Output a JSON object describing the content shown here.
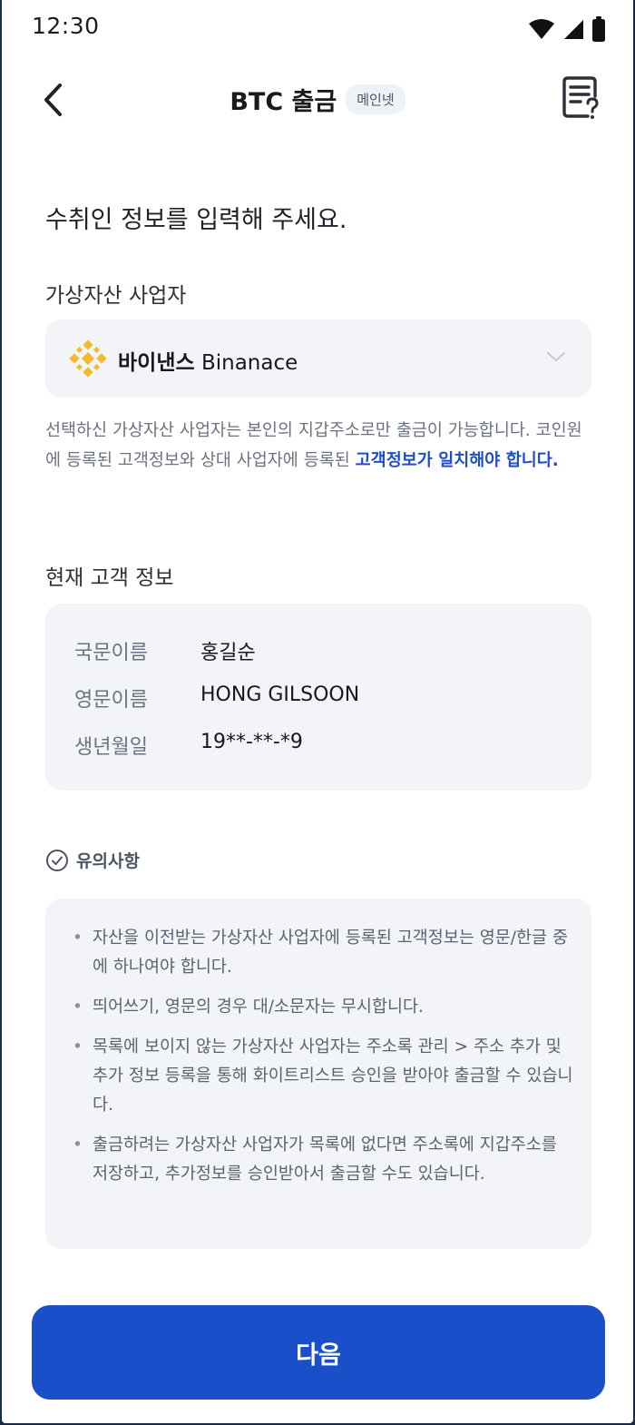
{
  "status_bar": {
    "time": "12:30"
  },
  "header": {
    "title": "BTC 출금",
    "network_badge": "메인넷"
  },
  "headline": "수취인 정보를 입력해 주세요.",
  "provider": {
    "label": "가상자산 사업자",
    "selected_name_ko": "바이낸스",
    "selected_name_en": "Binanace",
    "logo_color": "#f3ba2f"
  },
  "notice": {
    "text": "선택하신 가상자산 사업자는 본인의 지갑주소로만 출금이 가능합니다. 코인원에 등록된 고객정보와 상대 사업자에 등록된 ",
    "highlight": "고객정보가 일치해야 합니다."
  },
  "customer_info": {
    "label": "현재 고객 정보",
    "rows": [
      {
        "key": "국문이름",
        "value": "홍길순"
      },
      {
        "key": "영문이름",
        "value": "HONG GILSOON"
      },
      {
        "key": "생년월일",
        "value": "19**-**-*9"
      }
    ]
  },
  "caution": {
    "title": "유의사항",
    "items": [
      "자산을 이전받는 가상자산 사업자에 등록된 고객정보는 영문/한글 중에 하나여야 합니다.",
      "띄어쓰기, 영문의 경우 대/소문자는 무시합니다.",
      "목록에 보이지 않는 가상자산 사업자는 주소록 관리 > 주소 추가 및 추가 정보 등록을 통해 화이트리스트 승인을 받아야 출금할 수 있습니다.",
      "출금하려는 가상자산 사업자가 목록에 없다면 주소록에 지갑주소를 저장하고, 추가정보를 승인받아서 출금할 수도 있습니다."
    ]
  },
  "next_button": {
    "label": "다음"
  },
  "colors": {
    "primary": "#1a4fc9",
    "highlight": "#1f4fc6",
    "card_bg": "#f2f4f7"
  }
}
